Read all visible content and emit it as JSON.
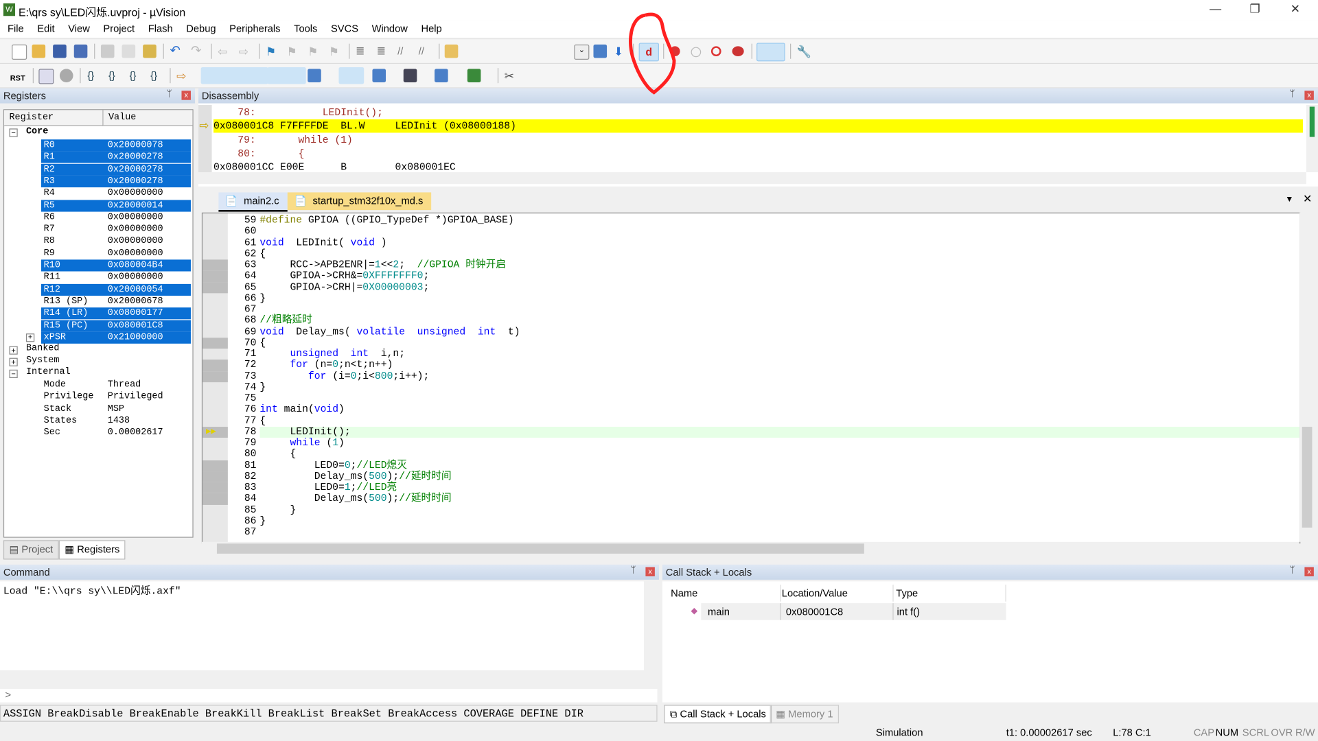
{
  "window": {
    "title": "E:\\qrs sy\\LED闪烁.uvproj - µVision",
    "minimize": "—",
    "maximize": "❐",
    "close": "✕"
  },
  "menu": [
    "File",
    "Edit",
    "View",
    "Project",
    "Flash",
    "Debug",
    "Peripherals",
    "Tools",
    "SVCS",
    "Window",
    "Help"
  ],
  "toolbar": {
    "reset_label": "RST",
    "highlighted_button": "start-stop-debug-session"
  },
  "registers": {
    "title": "Registers",
    "col_register": "Register",
    "col_value": "Value",
    "core_label": "Core",
    "rows": [
      {
        "name": "R0",
        "value": "0x20000078",
        "selected": true
      },
      {
        "name": "R1",
        "value": "0x20000278",
        "selected": true
      },
      {
        "name": "R2",
        "value": "0x20000278",
        "selected": true
      },
      {
        "name": "R3",
        "value": "0x20000278",
        "selected": true
      },
      {
        "name": "R4",
        "value": "0x00000000",
        "selected": false
      },
      {
        "name": "R5",
        "value": "0x20000014",
        "selected": true
      },
      {
        "name": "R6",
        "value": "0x00000000",
        "selected": false
      },
      {
        "name": "R7",
        "value": "0x00000000",
        "selected": false
      },
      {
        "name": "R8",
        "value": "0x00000000",
        "selected": false
      },
      {
        "name": "R9",
        "value": "0x00000000",
        "selected": false
      },
      {
        "name": "R10",
        "value": "0x080004B4",
        "selected": true
      },
      {
        "name": "R11",
        "value": "0x00000000",
        "selected": false
      },
      {
        "name": "R12",
        "value": "0x20000054",
        "selected": true
      },
      {
        "name": "R13 (SP)",
        "value": "0x20000678",
        "selected": false
      },
      {
        "name": "R14 (LR)",
        "value": "0x08000177",
        "selected": true
      },
      {
        "name": "R15 (PC)",
        "value": "0x080001C8",
        "selected": true
      },
      {
        "name": "xPSR",
        "value": "0x21000000",
        "selected": true
      }
    ],
    "groups": [
      "Banked",
      "System",
      "Internal"
    ],
    "internal": [
      {
        "name": "Mode",
        "value": "Thread"
      },
      {
        "name": "Privilege",
        "value": "Privileged"
      },
      {
        "name": "Stack",
        "value": "MSP"
      },
      {
        "name": "States",
        "value": "1438"
      },
      {
        "name": "Sec",
        "value": "0.00002617"
      }
    ],
    "tabs": [
      "Project",
      "Registers"
    ]
  },
  "disassembly": {
    "title": "Disassembly",
    "lines": [
      {
        "text": "    78:           LEDInit();",
        "kind": "src"
      },
      {
        "text": "0x080001C8 F7FFFFDE  BL.W     LEDInit (0x08000188)",
        "kind": "current"
      },
      {
        "text": "    79:       while (1)",
        "kind": "src"
      },
      {
        "text": "    80:       {",
        "kind": "src"
      },
      {
        "text": "0x080001CC E00E      B        0x080001EC",
        "kind": "asm"
      }
    ]
  },
  "editor": {
    "tabs": [
      {
        "label": "main2.c",
        "active": true
      },
      {
        "label": "startup_stm32f10x_md.s",
        "active": false
      }
    ],
    "current_line": 78,
    "covered_lines": [
      63,
      64,
      65,
      70,
      72,
      73,
      78,
      81,
      82,
      83,
      84
    ],
    "lines": [
      {
        "n": "59",
        "seg": [
          [
            "#define",
            "pp"
          ],
          [
            " GPIOA ((GPIO_TypeDef *)GPIOA_BASE)",
            ""
          ]
        ]
      },
      {
        "n": "60",
        "seg": []
      },
      {
        "n": "61",
        "seg": [
          [
            "void",
            "kw"
          ],
          [
            "  LEDInit( ",
            ""
          ],
          [
            "void",
            "kw"
          ],
          [
            " )",
            ""
          ]
        ]
      },
      {
        "n": "62",
        "seg": [
          [
            "{",
            ""
          ]
        ]
      },
      {
        "n": "63",
        "seg": [
          [
            "     RCC->APB2ENR|=",
            ""
          ],
          [
            "1",
            "num"
          ],
          [
            "<<",
            ""
          ],
          [
            "2",
            "num"
          ],
          [
            ";  ",
            ""
          ],
          [
            "//GPIOA 时钟开启",
            "cmt"
          ]
        ]
      },
      {
        "n": "64",
        "seg": [
          [
            "     GPIOA->CRH&=",
            ""
          ],
          [
            "0XFFFFFFF0",
            "num"
          ],
          [
            ";",
            ""
          ]
        ]
      },
      {
        "n": "65",
        "seg": [
          [
            "     GPIOA->CRH|=",
            ""
          ],
          [
            "0X00000003",
            "num"
          ],
          [
            ";",
            ""
          ]
        ]
      },
      {
        "n": "66",
        "seg": [
          [
            "}",
            ""
          ]
        ]
      },
      {
        "n": "67",
        "seg": []
      },
      {
        "n": "68",
        "seg": [
          [
            "//粗略延时",
            "cmt"
          ]
        ]
      },
      {
        "n": "69",
        "seg": [
          [
            "void",
            "kw"
          ],
          [
            "  Delay_ms( ",
            ""
          ],
          [
            "volatile",
            "kw"
          ],
          [
            "  ",
            ""
          ],
          [
            "unsigned",
            "kw"
          ],
          [
            "  ",
            ""
          ],
          [
            "int",
            "kw"
          ],
          [
            "  t)",
            ""
          ]
        ]
      },
      {
        "n": "70",
        "seg": [
          [
            "{",
            ""
          ]
        ]
      },
      {
        "n": "71",
        "seg": [
          [
            "     ",
            ""
          ],
          [
            "unsigned",
            "kw"
          ],
          [
            "  ",
            ""
          ],
          [
            "int",
            "kw"
          ],
          [
            "  i,n;",
            ""
          ]
        ]
      },
      {
        "n": "72",
        "seg": [
          [
            "     ",
            ""
          ],
          [
            "for",
            "kw"
          ],
          [
            " (n=",
            ""
          ],
          [
            "0",
            "num"
          ],
          [
            ";n<t;n++)",
            ""
          ]
        ]
      },
      {
        "n": "73",
        "seg": [
          [
            "        ",
            ""
          ],
          [
            "for",
            "kw"
          ],
          [
            " (i=",
            ""
          ],
          [
            "0",
            "num"
          ],
          [
            ";i<",
            ""
          ],
          [
            "800",
            "num"
          ],
          [
            ";i++);",
            ""
          ]
        ]
      },
      {
        "n": "74",
        "seg": [
          [
            "}",
            ""
          ]
        ]
      },
      {
        "n": "75",
        "seg": []
      },
      {
        "n": "76",
        "seg": [
          [
            "int",
            "kw"
          ],
          [
            " main(",
            ""
          ],
          [
            "void",
            "kw"
          ],
          [
            ")",
            ""
          ]
        ]
      },
      {
        "n": "77",
        "seg": [
          [
            "{",
            ""
          ]
        ]
      },
      {
        "n": "78",
        "seg": [
          [
            "     LEDInit();",
            ""
          ]
        ]
      },
      {
        "n": "79",
        "seg": [
          [
            "     ",
            ""
          ],
          [
            "while",
            "kw"
          ],
          [
            " (",
            ""
          ],
          [
            "1",
            "num"
          ],
          [
            ")",
            ""
          ]
        ]
      },
      {
        "n": "80",
        "seg": [
          [
            "     {",
            ""
          ]
        ]
      },
      {
        "n": "81",
        "seg": [
          [
            "         LED0=",
            ""
          ],
          [
            "0",
            "num"
          ],
          [
            ";",
            ""
          ],
          [
            "//LED熄灭",
            "cmt"
          ]
        ]
      },
      {
        "n": "82",
        "seg": [
          [
            "         Delay_ms(",
            ""
          ],
          [
            "500",
            "num"
          ],
          [
            ");",
            ""
          ],
          [
            "//延时时间",
            "cmt"
          ]
        ]
      },
      {
        "n": "83",
        "seg": [
          [
            "         LED0=",
            ""
          ],
          [
            "1",
            "num"
          ],
          [
            ";",
            ""
          ],
          [
            "//LED亮",
            "cmt"
          ]
        ]
      },
      {
        "n": "84",
        "seg": [
          [
            "         Delay_ms(",
            ""
          ],
          [
            "500",
            "num"
          ],
          [
            ");",
            ""
          ],
          [
            "//延时时间",
            "cmt"
          ]
        ]
      },
      {
        "n": "85",
        "seg": [
          [
            "     }",
            ""
          ]
        ]
      },
      {
        "n": "86",
        "seg": [
          [
            "}",
            ""
          ]
        ]
      },
      {
        "n": "87",
        "seg": []
      }
    ]
  },
  "command": {
    "title": "Command",
    "output": "Load \"E:\\\\qrs sy\\\\LED闪烁.axf\"",
    "prompt": ">",
    "help": "ASSIGN BreakDisable BreakEnable BreakKill BreakList BreakSet BreakAccess COVERAGE DEFINE DIR"
  },
  "callstack": {
    "title": "Call Stack + Locals",
    "columns": [
      "Name",
      "Location/Value",
      "Type"
    ],
    "rows": [
      {
        "name": "main",
        "location": "0x080001C8",
        "type": "int f()"
      }
    ],
    "tabs": [
      "Call Stack + Locals",
      "Memory 1"
    ]
  },
  "status": {
    "mode": "Simulation",
    "time": "t1: 0.00002617 sec",
    "position": "L:78 C:1",
    "indicators": [
      "CAP",
      "NUM",
      "SCRL",
      "OVR",
      "R/W"
    ]
  },
  "colors": {
    "selection": "#0a6fd4",
    "current_line_disasm": "#ffff00",
    "current_line_editor": "#e6ffe6",
    "annotation": "#ff2020"
  }
}
